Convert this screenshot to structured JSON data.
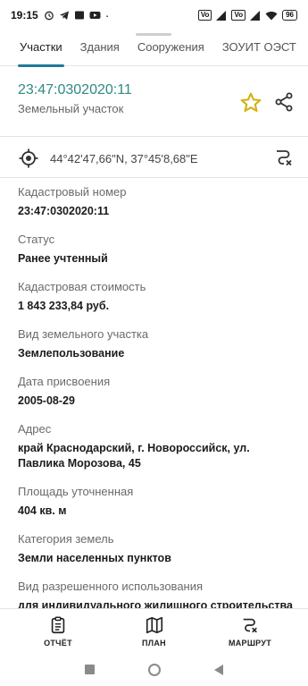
{
  "status_bar": {
    "time": "19:15",
    "net_badges": [
      "Vo",
      "Vo"
    ],
    "battery": "96"
  },
  "tabs": [
    {
      "label": "Участки",
      "active": true
    },
    {
      "label": "Здания",
      "active": false
    },
    {
      "label": "Сооружения",
      "active": false
    },
    {
      "label": "ЗОУИТ ОЭСТ",
      "active": false
    }
  ],
  "header": {
    "cadastral_number": "23:47:0302020:11",
    "object_type": "Земельный участок"
  },
  "coords": {
    "text": "44°42'47,66\"N, 37°45'8,68\"E"
  },
  "fields": [
    {
      "label": "Кадастровый номер",
      "value": "23:47:0302020:11"
    },
    {
      "label": "Статус",
      "value": "Ранее учтенный"
    },
    {
      "label": "Кадастровая стоимость",
      "value": "1 843 233,84 руб."
    },
    {
      "label": "Вид земельного участка",
      "value": "Землепользование"
    },
    {
      "label": "Дата присвоения",
      "value": "2005-08-29"
    },
    {
      "label": "Адрес",
      "value": "край Краснодарский, г. Новороссийск, ул. Павлика Морозова, 45"
    },
    {
      "label": "Площадь уточненная",
      "value": "404 кв. м"
    },
    {
      "label": "Категория земель",
      "value": "Земли населенных пунктов"
    },
    {
      "label": "Вид разрешенного использования",
      "value": "для индивидуального жилищного строительства"
    }
  ],
  "bottom_bar": {
    "report": "ОТЧЁТ",
    "plan": "ПЛАН",
    "route": "МАРШРУТ"
  },
  "colors": {
    "accent": "#1f7a9a",
    "title": "#2f8a82",
    "star": "#d4b316"
  }
}
